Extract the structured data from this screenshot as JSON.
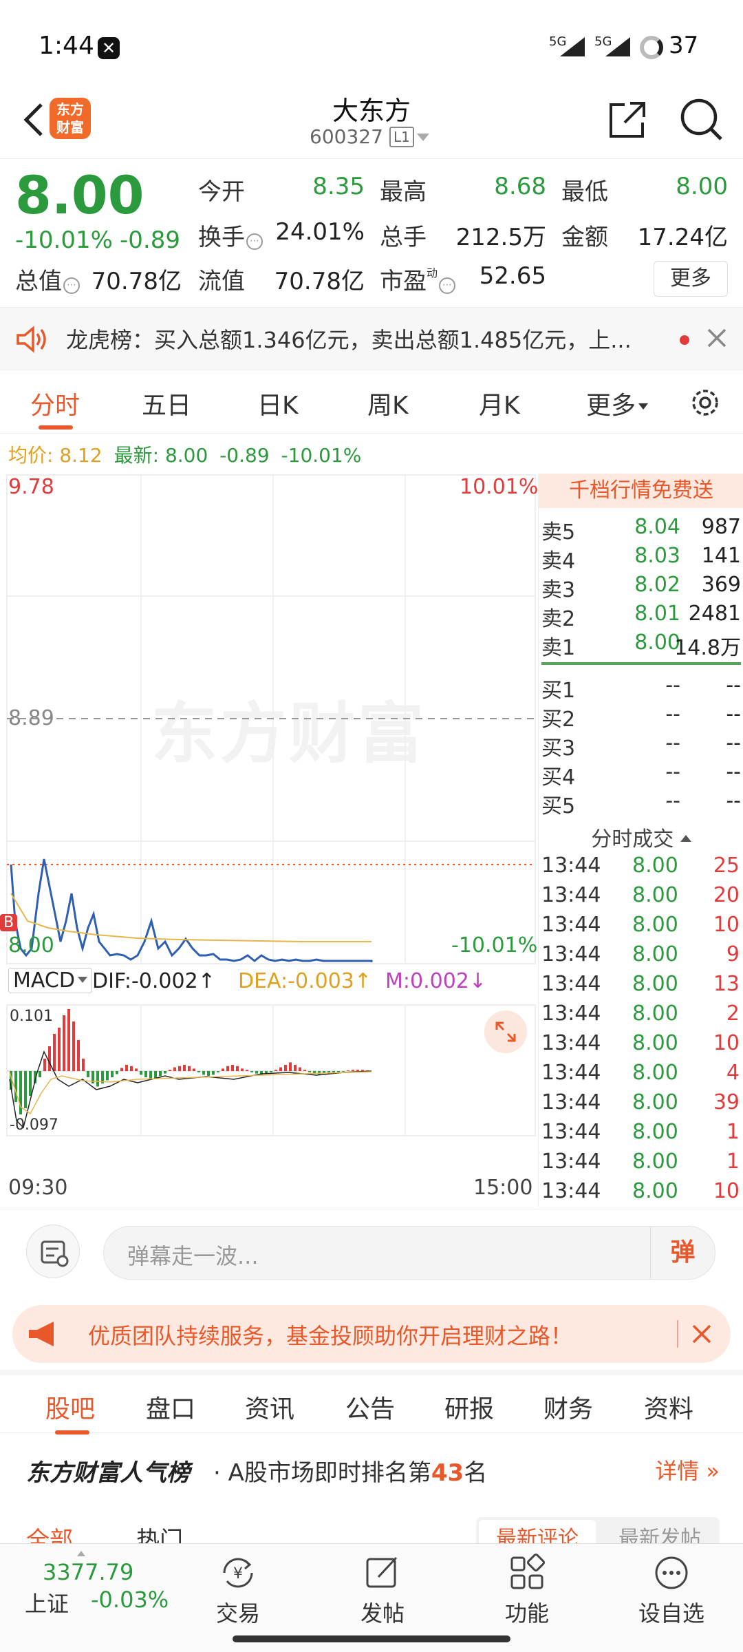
{
  "status": {
    "time": "1:44",
    "sig1": "5G",
    "sig2": "5G",
    "battery": "37"
  },
  "header": {
    "name": "大东方",
    "code": "600327",
    "level": "L1",
    "logo_line1": "东方",
    "logo_line2": "财富"
  },
  "quote": {
    "price": "8.00",
    "pct": "-10.01%",
    "chg": "-0.89",
    "rows": [
      [
        {
          "label": "今开",
          "value": "8.35",
          "color": "green"
        },
        {
          "label": "最高",
          "value": "8.68",
          "color": "green"
        },
        {
          "label": "最低",
          "value": "8.00",
          "color": "green"
        }
      ],
      [
        {
          "label": "换手",
          "value": "24.01%",
          "color": "black"
        },
        {
          "label": "总手",
          "value": "212.5万",
          "color": "black"
        },
        {
          "label": "金额",
          "value": "17.24亿",
          "color": "black"
        }
      ],
      [
        {
          "label": "总值",
          "value": "70.78亿",
          "color": "black"
        },
        {
          "label": "流值",
          "value": "70.78亿",
          "color": "black"
        },
        {
          "label": "市盈",
          "value": "52.65",
          "color": "black"
        }
      ]
    ],
    "pe_sup": "动",
    "more": "更多"
  },
  "dragon": {
    "text": "龙虎榜：买入总额1.346亿元，卖出总额1.485亿元，上..."
  },
  "chart_tabs": [
    "分时",
    "五日",
    "日K",
    "周K",
    "月K",
    "更多"
  ],
  "avg": {
    "avg_label": "均价:",
    "avg_value": "8.12",
    "latest_label": "最新:",
    "latest_value": "8.00",
    "chg": "-0.89",
    "pct": "-10.01%"
  },
  "chart_labels": {
    "top_price": "9.78",
    "top_pct": "10.01%",
    "mid_price": "8.89",
    "bottom_price": "8.00",
    "bottom_pct": "-10.01%",
    "watermark": "东方财富",
    "b_marker": "B",
    "time_start": "09:30",
    "time_end": "15:00"
  },
  "macd": {
    "name": "MACD",
    "dif": "DIF:-0.002↑",
    "dea": "DEA:-0.003↑",
    "m": "M:0.002↓",
    "top": "0.101",
    "bottom": "-0.097"
  },
  "book": {
    "promo": "千档行情免费送",
    "asks": [
      {
        "label": "卖5",
        "price": "8.04",
        "vol": "987"
      },
      {
        "label": "卖4",
        "price": "8.03",
        "vol": "141"
      },
      {
        "label": "卖3",
        "price": "8.02",
        "vol": "369"
      },
      {
        "label": "卖2",
        "price": "8.01",
        "vol": "2481"
      },
      {
        "label": "卖1",
        "price": "8.00",
        "vol": "14.8万"
      }
    ],
    "bids": [
      {
        "label": "买1",
        "price": "--",
        "vol": "--"
      },
      {
        "label": "买2",
        "price": "--",
        "vol": "--"
      },
      {
        "label": "买3",
        "price": "--",
        "vol": "--"
      },
      {
        "label": "买4",
        "price": "--",
        "vol": "--"
      },
      {
        "label": "买5",
        "price": "--",
        "vol": "--"
      }
    ],
    "ticks_header": "分时成交",
    "ticks": [
      {
        "time": "13:44",
        "price": "8.00",
        "vol": "25",
        "color": "red"
      },
      {
        "time": "13:44",
        "price": "8.00",
        "vol": "20",
        "color": "red"
      },
      {
        "time": "13:44",
        "price": "8.00",
        "vol": "10",
        "color": "red"
      },
      {
        "time": "13:44",
        "price": "8.00",
        "vol": "9",
        "color": "red"
      },
      {
        "time": "13:44",
        "price": "8.00",
        "vol": "13",
        "color": "red"
      },
      {
        "time": "13:44",
        "price": "8.00",
        "vol": "2",
        "color": "red"
      },
      {
        "time": "13:44",
        "price": "8.00",
        "vol": "10",
        "color": "red"
      },
      {
        "time": "13:44",
        "price": "8.00",
        "vol": "4",
        "color": "red"
      },
      {
        "time": "13:44",
        "price": "8.00",
        "vol": "39",
        "color": "red"
      },
      {
        "time": "13:44",
        "price": "8.00",
        "vol": "1",
        "color": "red"
      },
      {
        "time": "13:44",
        "price": "8.00",
        "vol": "1",
        "color": "red"
      },
      {
        "time": "13:44",
        "price": "8.00",
        "vol": "10",
        "color": "red"
      }
    ]
  },
  "danmaku": {
    "placeholder": "弹幕走一波...",
    "button": "弹"
  },
  "ad": {
    "text": "优质团队持续服务，基金投顾助你开启理财之路！"
  },
  "sub_tabs": [
    "股吧",
    "盘口",
    "资讯",
    "公告",
    "研报",
    "财务",
    "资料"
  ],
  "popularity": {
    "brand": "东方财富人气榜",
    "prefix": "· A股市场即时排名第",
    "rank": "43",
    "suffix": "名",
    "detail": "详情"
  },
  "filters": {
    "all": "全部",
    "hot": "热门",
    "latest_comment": "最新评论",
    "latest_post": "最新发帖"
  },
  "bottom_nav": {
    "index_value": "3377.79",
    "index_name": "上证",
    "index_pct": "-0.03%",
    "items": [
      "交易",
      "发帖",
      "功能",
      "设自选"
    ]
  },
  "colors": {
    "accent": "#e8582a",
    "down": "#2b9a3d",
    "up": "#e23b3b",
    "line": "#2f5fb0",
    "avg": "#e8b54a"
  }
}
